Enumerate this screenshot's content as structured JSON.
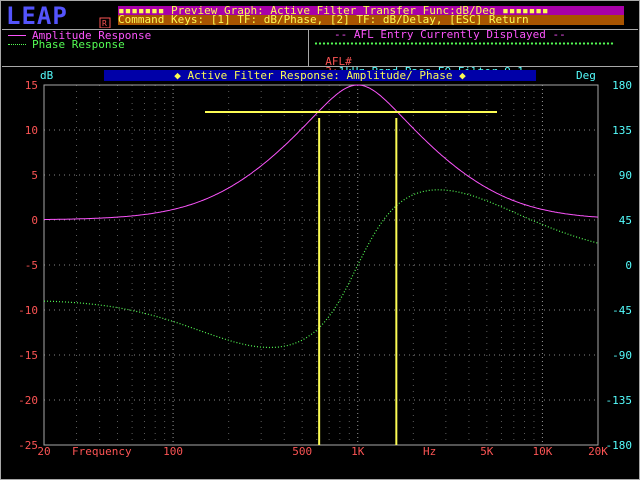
{
  "logo": {
    "text": "LEAP",
    "mark": "R"
  },
  "header": {
    "line1": "▪▪▪▪▪▪▪ Preview Graph: Active Filter Transfer Func:dB/Deg ▪▪▪▪▪▪▪",
    "line2": "Command Keys: [1] TF: dB/Phase, [2] TF: dB/Delay, [ESC] Return"
  },
  "legend": {
    "amplitude": "Amplitude Response",
    "phase": "Phase Response"
  },
  "afl_panel": {
    "title": "-- AFL Entry Currently Displayed --",
    "label": "AFL#",
    "number": "3:",
    "description": "1kHz Band Pass EQ Filter Q=1"
  },
  "graph": {
    "title": "◆ Active Filter Response: Amplitude/ Phase ◆",
    "left_unit": "dB",
    "right_unit": "Deg",
    "frequency_label": "Frequency",
    "hz_label": "Hz"
  },
  "colors": {
    "amplitude": "#fc54fc",
    "phase": "#54fc54",
    "markers": "#fcfc54",
    "tick_left": "#fc5454",
    "tick_right": "#54fcfc"
  },
  "chart_data": {
    "type": "line",
    "x_scale": "log",
    "xlim": [
      20,
      20000
    ],
    "ylim": [
      -25,
      15
    ],
    "y2lim": [
      -180,
      180
    ],
    "y_ticks": [
      "15",
      "10",
      "5",
      "0",
      "-5",
      "-10",
      "-15",
      "-20",
      "-25"
    ],
    "y2_ticks": [
      "180",
      "135",
      "90",
      "45",
      "0",
      "-45",
      "-90",
      "-135",
      "-180"
    ],
    "x_ticks": [
      {
        "value": 20,
        "label": "20"
      },
      {
        "value": 100,
        "label": "100"
      },
      {
        "value": 500,
        "label": "500"
      },
      {
        "value": 1000,
        "label": "1K"
      },
      {
        "value": 5000,
        "label": "5K"
      },
      {
        "value": 10000,
        "label": "10K"
      },
      {
        "value": 20000,
        "label": "20K"
      }
    ],
    "center_frequency": 1000,
    "q": 1,
    "peak_db": 15,
    "phase_bottom_deg": -90,
    "markers": {
      "level_db": 12,
      "f_low": 618,
      "f_high": 1618
    },
    "series": [
      {
        "name": "Amplitude Response",
        "axis": "left"
      },
      {
        "name": "Phase Response",
        "axis": "right"
      }
    ]
  }
}
